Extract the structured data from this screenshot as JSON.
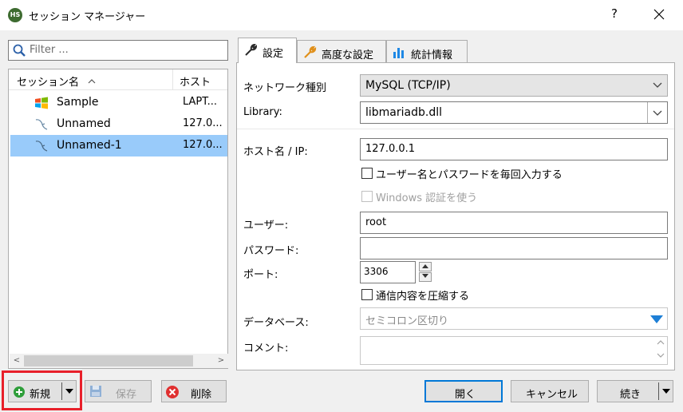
{
  "window": {
    "title": "セッション マネージャー",
    "app_icon_text": "HS",
    "help": "?"
  },
  "filter": {
    "placeholder": "Filter ..."
  },
  "session_list": {
    "columns": {
      "name": "セッション名",
      "host": "ホスト"
    },
    "sort_indicator": "^",
    "rows": [
      {
        "name": "Sample",
        "host": "LAPT...",
        "icon": "windows-logo-icon",
        "selected": false
      },
      {
        "name": "Unnamed",
        "host": "127.0...",
        "icon": "mysql-dolphin-icon",
        "selected": false
      },
      {
        "name": "Unnamed-1",
        "host": "127.0...",
        "icon": "mysql-dolphin-icon",
        "selected": true
      }
    ],
    "scroll_left": "<",
    "scroll_right": ">"
  },
  "tabs": [
    {
      "label": "設定",
      "icon": "wrench-icon",
      "active": true
    },
    {
      "label": "高度な設定",
      "icon": "wrench-orange-icon",
      "active": false
    },
    {
      "label": "統計情報",
      "icon": "bar-chart-icon",
      "active": false
    }
  ],
  "settings": {
    "network_type": {
      "label": "ネットワーク種別",
      "value": "MySQL (TCP/IP)"
    },
    "library": {
      "label": "Library:",
      "value": "libmariadb.dll"
    },
    "host": {
      "label": "ホスト名 / IP:",
      "value": "127.0.0.1"
    },
    "prompt_login": {
      "label": "ユーザー名とパスワードを毎回入力する",
      "checked": false
    },
    "windows_auth": {
      "label": "Windows 認証を使う",
      "checked": false,
      "disabled": true
    },
    "user": {
      "label": "ユーザー:",
      "value": "root"
    },
    "password": {
      "label": "パスワード:",
      "value": ""
    },
    "port": {
      "label": "ポート:",
      "value": "3306"
    },
    "compressed": {
      "label": "通信内容を圧縮する",
      "checked": false
    },
    "databases": {
      "label": "データベース:",
      "placeholder": "セミコロン区切り"
    },
    "comment": {
      "label": "コメント:",
      "value": ""
    }
  },
  "buttons": {
    "new": "新規",
    "save": "保存",
    "delete": "削除",
    "open": "開く",
    "cancel": "キャンセル",
    "more": "続き"
  },
  "colors": {
    "selection": "#99cbfa",
    "highlight_border": "#e8202a",
    "default_button_border": "#0078d7"
  }
}
